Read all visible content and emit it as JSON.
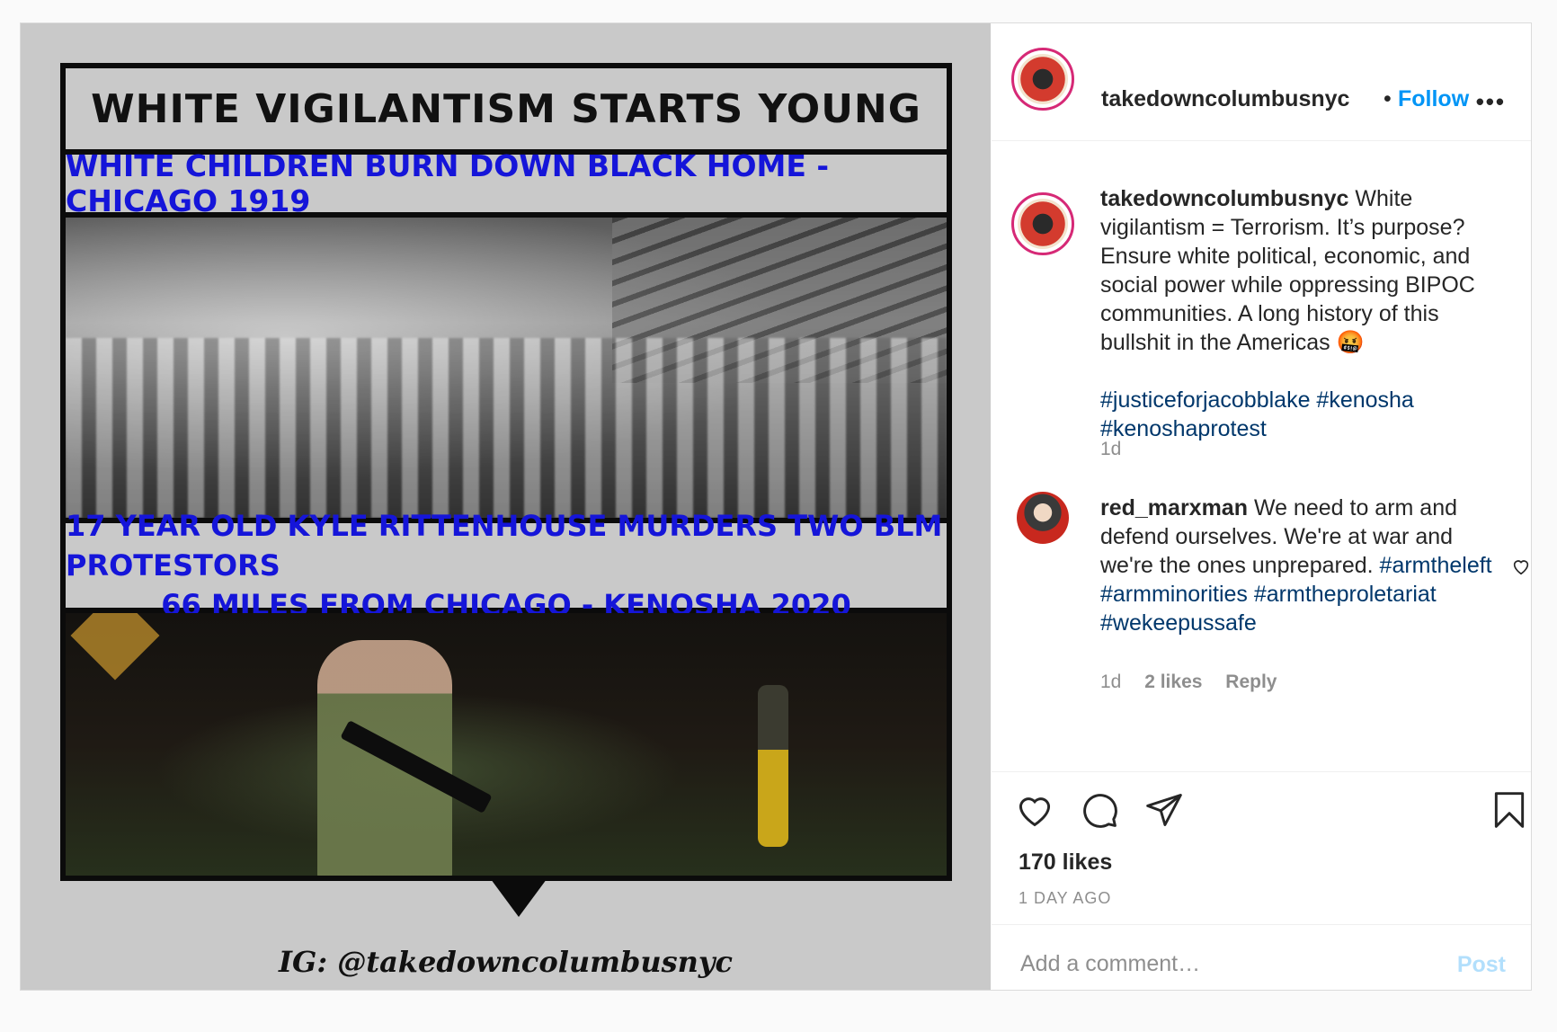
{
  "image": {
    "title": "WHITE VIGILANTISM STARTS YOUNG",
    "subtitle_1919": "WHITE CHILDREN BURN DOWN BLACK HOME - CHICAGO 1919",
    "caption_2020_line1": "17 YEAR OLD KYLE RITTENHOUSE MURDERS TWO BLM PROTESTORS",
    "caption_2020_line2": "66 MILES FROM CHICAGO - KENOSHA 2020",
    "watermark": "IG: @takedowncolumbusnyc"
  },
  "header": {
    "username": "takedowncolumbusnyc",
    "separator": "•",
    "follow_label": "Follow",
    "more_label": "•••"
  },
  "caption": {
    "username": "takedowncolumbusnyc",
    "text": "White vigilantism = Terrorism. It’s purpose? Ensure white political, economic, and social power while oppressing BIPOC communities. A long history of this bullshit in the Americas 🤬",
    "hashtags": "#justiceforjacobblake #kenosha #kenoshaprotest",
    "time": "1d"
  },
  "comment": {
    "username": "red_marxman",
    "text": "We need to arm and defend ourselves. We're at war and we're the ones unprepared.",
    "hashtags": "#armtheleft #armminorities #armtheproletariat #wekeepussafe",
    "time": "1d",
    "likes": "2 likes",
    "reply": "Reply"
  },
  "actions": {
    "likes_count": "170 likes",
    "date": "1 DAY AGO"
  },
  "add_comment": {
    "placeholder": "Add a comment…",
    "post_label": "Post"
  },
  "colors": {
    "link_blue": "#0095f6",
    "hashtag_blue": "#00376b",
    "banner_blue": "#1515d9",
    "muted": "#8e8e8e"
  },
  "icons": [
    "heart-icon",
    "comment-icon",
    "share-icon",
    "bookmark-icon",
    "more-icon"
  ]
}
